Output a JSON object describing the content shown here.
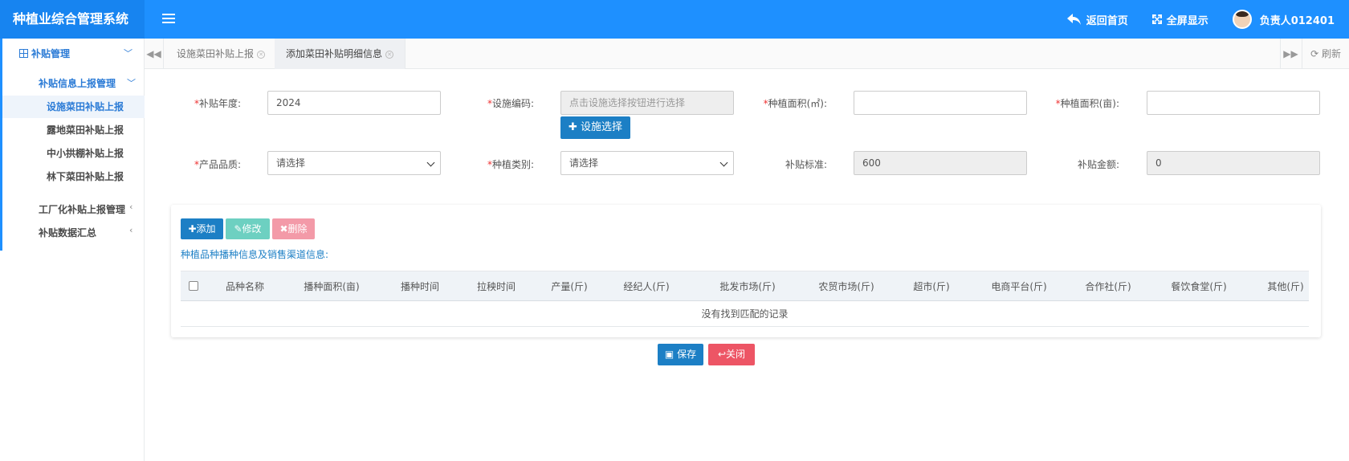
{
  "app": {
    "title": "种植业综合管理系统"
  },
  "header": {
    "home_label": "返回首页",
    "fullscreen_label": "全屏显示",
    "user_label": "负责人012401"
  },
  "sidebar": {
    "group_label": "补贴管理",
    "sub1_label": "补贴信息上报管理",
    "leaves": [
      "设施菜田补贴上报",
      "露地菜田补贴上报",
      "中小拱棚补贴上报",
      "林下菜田补贴上报"
    ],
    "sub2_label": "工厂化补贴上报管理",
    "sub3_label": "补贴数据汇总"
  },
  "tabs": [
    {
      "label": "设施菜田补贴上报",
      "active": false
    },
    {
      "label": "添加菜田补贴明细信息",
      "active": true
    }
  ],
  "refresh_label": "刷新",
  "form": {
    "year_label": "补贴年度:",
    "year_value": "2024",
    "code_label": "设施编码:",
    "code_placeholder": "点击设施选择按钮进行选择",
    "facility_btn": "设施选择",
    "area_m2_label": "种植面积(㎡):",
    "area_mu_label": "种植面积(亩):",
    "quality_label": "产品品质:",
    "quality_value": "请选择",
    "category_label": "种植类别:",
    "category_value": "请选择",
    "standard_label": "补贴标准:",
    "standard_value": "600",
    "amount_label": "补贴金额:",
    "amount_value": "0"
  },
  "panel": {
    "add_btn": "添加",
    "edit_btn": "修改",
    "delete_btn": "删除",
    "title": "种植品种播种信息及销售渠道信息:",
    "columns": [
      "品种名称",
      "播种面积(亩)",
      "播种时间",
      "拉秧时间",
      "产量(斤)",
      "经纪人(斤)",
      "批发市场(斤)",
      "农贸市场(斤)",
      "超市(斤)",
      "电商平台(斤)",
      "合作社(斤)",
      "餐饮食堂(斤)",
      "其他(斤)"
    ],
    "empty_text": "没有找到匹配的记录"
  },
  "actions": {
    "save": "保存",
    "close": "关闭"
  },
  "colors": {
    "brand": "#1e90ff",
    "primary": "#1c7fc5",
    "danger": "#ed5565",
    "required": "#e33333"
  }
}
